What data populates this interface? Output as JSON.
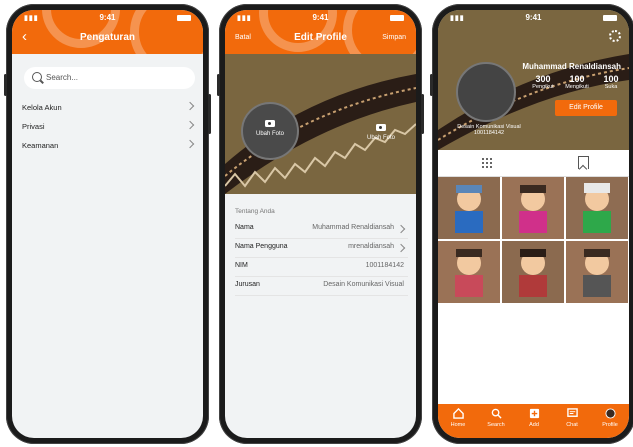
{
  "status": {
    "time": "9:41"
  },
  "settings": {
    "title": "Pengaturan",
    "search_placeholder": "Search...",
    "items": [
      {
        "label": "Kelola Akun"
      },
      {
        "label": "Privasi"
      },
      {
        "label": "Keamanan"
      }
    ]
  },
  "edit_profile": {
    "title": "Edit Profile",
    "cancel": "Batal",
    "save": "Simpan",
    "change_photo": "Ubah Foto",
    "change_cover": "Ubah Foto",
    "section_title": "Tentang Anda",
    "fields": [
      {
        "label": "Nama",
        "value": "Muhammad Renaldiansah"
      },
      {
        "label": "Nama Pengguna",
        "value": "mrenaldiansah"
      },
      {
        "label": "NIM",
        "value": "1001184142"
      },
      {
        "label": "Jurusan",
        "value": "Desain Komunikasi Visual"
      }
    ]
  },
  "profile": {
    "name": "Muhammad Renaldiansah",
    "stats": [
      {
        "value": "300",
        "label": "Pengikut"
      },
      {
        "value": "100",
        "label": "Mengikuti"
      },
      {
        "value": "100",
        "label": "Suka"
      }
    ],
    "edit_button": "Edit Profile",
    "bio_line1": "Desain Komunikasi Visual",
    "bio_line2": "1001184142",
    "nav": [
      {
        "label": "Home",
        "icon": "home-icon"
      },
      {
        "label": "Search",
        "icon": "search-icon"
      },
      {
        "label": "Add",
        "icon": "add-icon"
      },
      {
        "label": "Chat",
        "icon": "chat-icon"
      },
      {
        "label": "Profile",
        "icon": "profile-icon"
      }
    ]
  },
  "colors": {
    "accent": "#f26a0c",
    "background": "#f1f3f4"
  }
}
